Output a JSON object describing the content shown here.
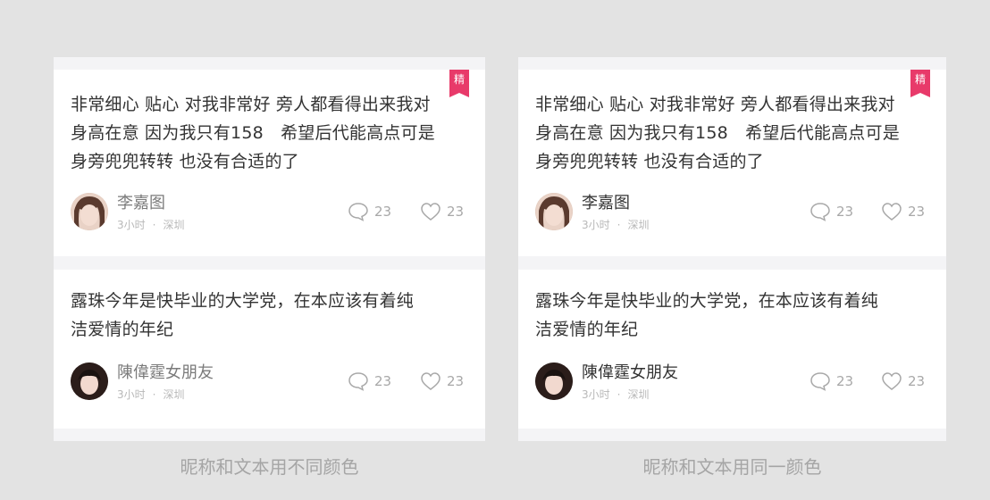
{
  "panels": [
    {
      "caption": "昵称和文本用不同颜色",
      "posts": [
        {
          "badge": "精",
          "text": "非常细心 贴心 对我非常好 旁人都看得出来我对\n身高在意 因为我只有158　希望后代能高点可是\n身旁兜兜转转 也没有合适的了",
          "name": "李嘉图",
          "time": "3小时",
          "location": "深圳",
          "comments": "23",
          "likes": "23"
        },
        {
          "text": "露珠今年是快毕业的大学党，在本应该有着纯\n洁爱情的年纪",
          "name": "陳偉霆女朋友",
          "time": "3小时",
          "location": "深圳",
          "comments": "23",
          "likes": "23"
        }
      ]
    },
    {
      "caption": "昵称和文本用同一颜色",
      "posts": [
        {
          "badge": "精",
          "text": "非常细心 贴心 对我非常好 旁人都看得出来我对\n身高在意 因为我只有158　希望后代能高点可是\n身旁兜兜转转 也没有合适的了",
          "name": "李嘉图",
          "time": "3小时",
          "location": "深圳",
          "comments": "23",
          "likes": "23"
        },
        {
          "text": "露珠今年是快毕业的大学党，在本应该有着纯\n洁爱情的年纪",
          "name": "陳偉霆女朋友",
          "time": "3小时",
          "location": "深圳",
          "comments": "23",
          "likes": "23"
        }
      ]
    }
  ],
  "separator": "·",
  "colors": {
    "badge": "#e83a6a",
    "name_different": "#7b7b7b",
    "name_same": "#333333",
    "body_text": "#333333"
  },
  "icons": {
    "comment": "comment-bubble-icon",
    "like": "heart-icon"
  }
}
